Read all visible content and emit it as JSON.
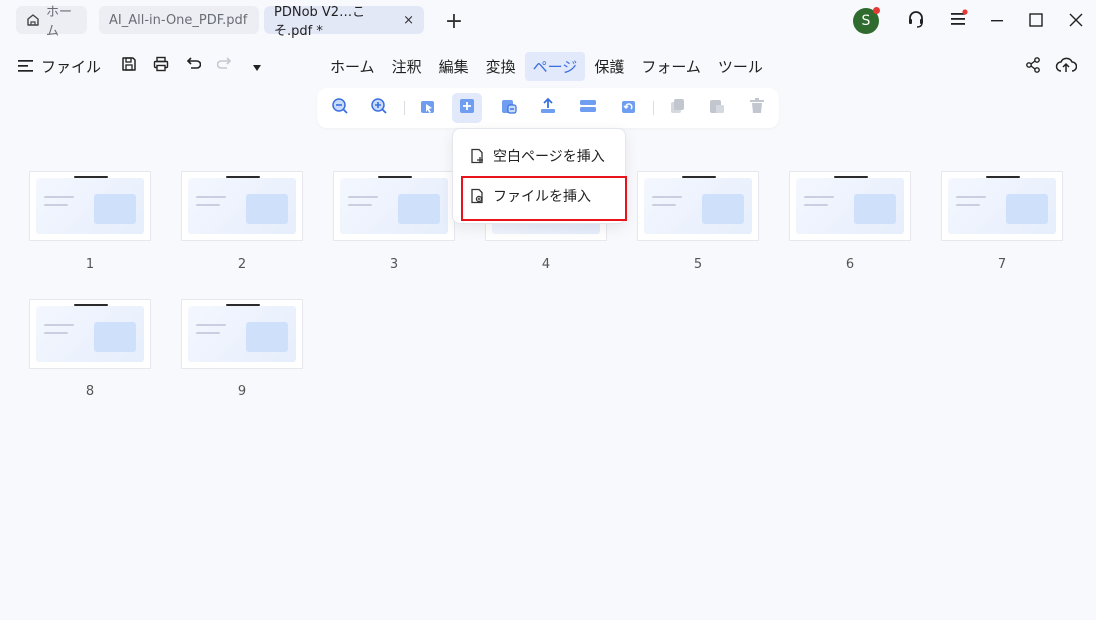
{
  "tabs": [
    {
      "label": "ホーム",
      "icon": "home-icon"
    },
    {
      "label": "AI_All-in-One_PDF.pdf"
    },
    {
      "label": "PDNob V2…こそ.pdf *",
      "close": "×"
    }
  ],
  "new_tab": "+",
  "user": {
    "initial": "S"
  },
  "window_controls": [
    "minimize-icon",
    "maximize-icon",
    "close-icon"
  ],
  "file_menu": {
    "label": "ファイル"
  },
  "main_menu": [
    {
      "label": "ホーム"
    },
    {
      "label": "注釈"
    },
    {
      "label": "編集"
    },
    {
      "label": "変換"
    },
    {
      "label": "ページ",
      "active": true
    },
    {
      "label": "保護"
    },
    {
      "label": "フォーム"
    },
    {
      "label": "ツール"
    }
  ],
  "toolbar_icons": [
    "zoom-out-icon",
    "zoom-in-icon",
    "select-page-icon",
    "insert-page-icon",
    "replace-page-icon",
    "extract-page-icon",
    "split-page-icon",
    "rotate-page-icon",
    "copy-page-icon",
    "paste-page-icon",
    "delete-page-icon"
  ],
  "insert_menu": [
    {
      "label": "空白ページを挿入",
      "icon": "blank-page-icon"
    },
    {
      "label": "ファイルを挿入",
      "icon": "file-insert-icon"
    }
  ],
  "pages": [
    "1",
    "2",
    "3",
    "4",
    "5",
    "6",
    "7",
    "8",
    "9"
  ],
  "colors": {
    "accent": "#3a6fe0",
    "highlight": "#e8141c",
    "avatar": "#2f6b2f"
  }
}
